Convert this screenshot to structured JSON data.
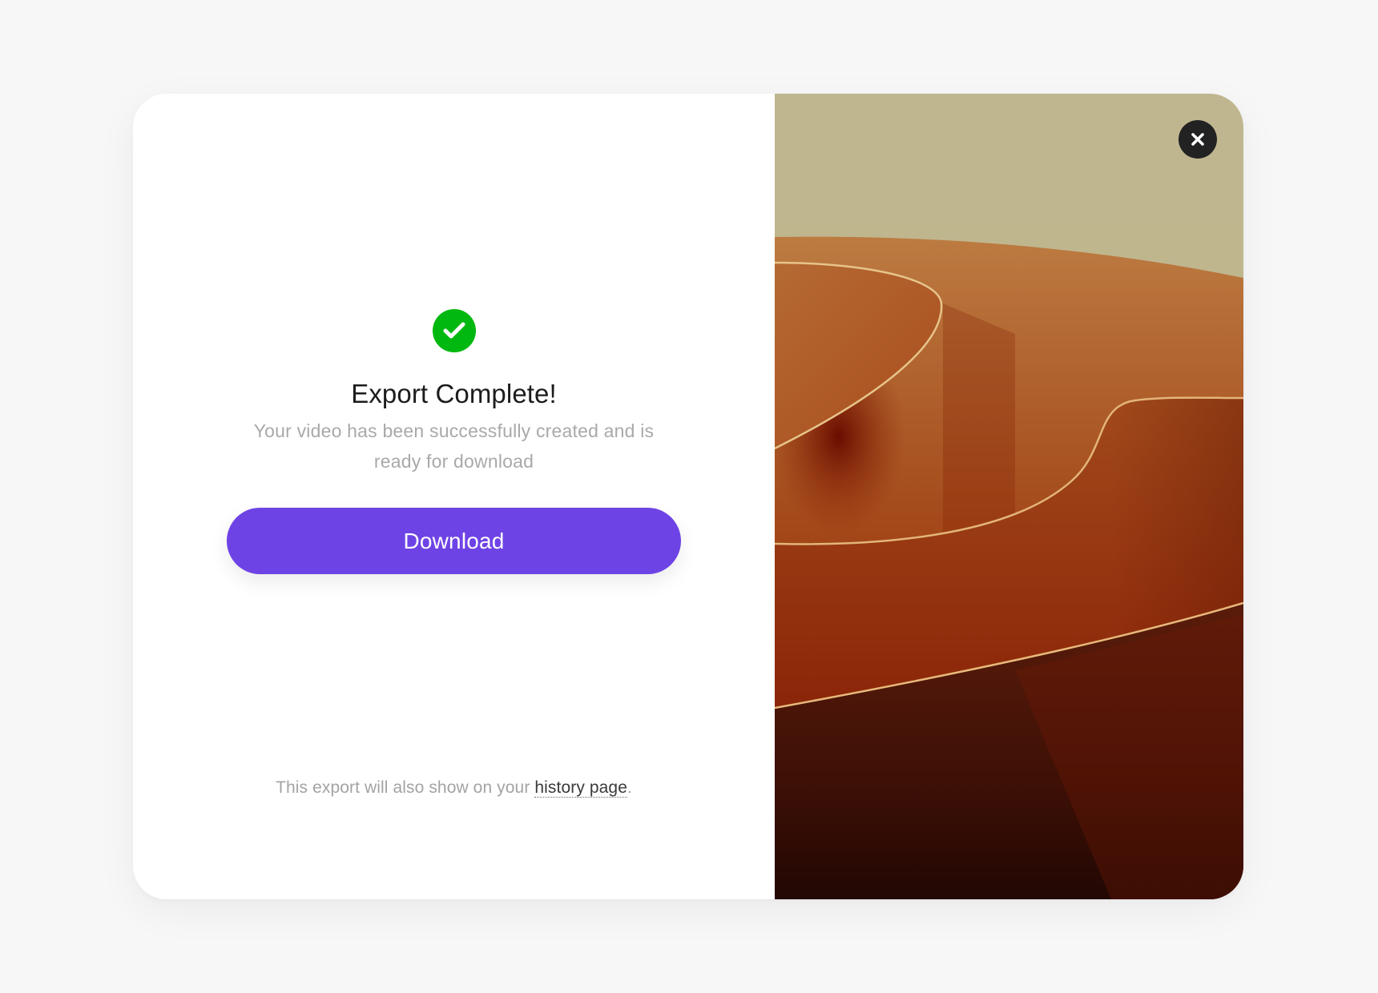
{
  "dialog": {
    "success_icon": "check-circle-icon",
    "title": "Export Complete!",
    "subtitle": "Your video has been successfully created and is ready for download",
    "download_label": "Download",
    "footer_prefix": "This export will also show on your ",
    "footer_link": "history page",
    "footer_suffix": ".",
    "close_icon": "close-icon",
    "image_icon": "abstract-orange-waves-image"
  },
  "colors": {
    "accent": "#6e43e5",
    "success": "#00b80f",
    "close_bg": "#222222",
    "page_bg": "#f7f7f7"
  }
}
